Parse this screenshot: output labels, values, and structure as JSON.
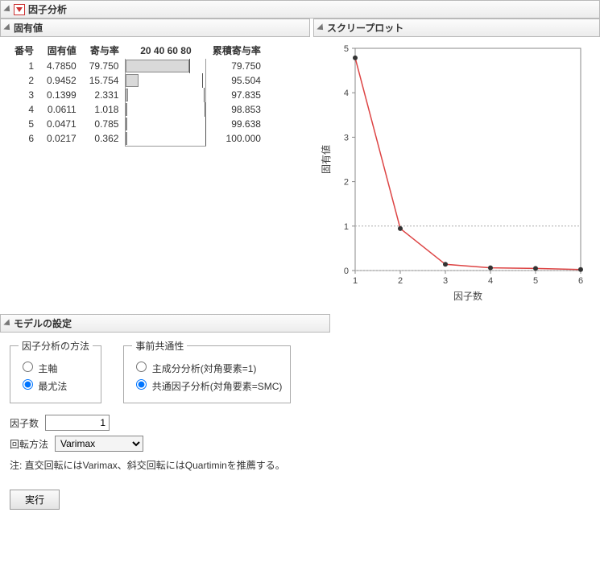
{
  "title": "因子分析",
  "eigen": {
    "title": "固有値",
    "headers": {
      "num": "番号",
      "eigen": "固有値",
      "contrib": "寄与率",
      "bar": "20 40 60 80",
      "cum": "累積寄与率"
    },
    "rows": [
      {
        "num": "1",
        "eigen": "4.7850",
        "contrib": "79.750",
        "cum": "79.750"
      },
      {
        "num": "2",
        "eigen": "0.9452",
        "contrib": "15.754",
        "cum": "95.504"
      },
      {
        "num": "3",
        "eigen": "0.1399",
        "contrib": "2.331",
        "cum": "97.835"
      },
      {
        "num": "4",
        "eigen": "0.0611",
        "contrib": "1.018",
        "cum": "98.853"
      },
      {
        "num": "5",
        "eigen": "0.0471",
        "contrib": "0.785",
        "cum": "99.638"
      },
      {
        "num": "6",
        "eigen": "0.0217",
        "contrib": "0.362",
        "cum": "100.000"
      }
    ]
  },
  "scree": {
    "title": "スクリープロット",
    "xlabel": "因子数",
    "ylabel": "固有値"
  },
  "model": {
    "title": "モデルの設定",
    "method_legend": "因子分析の方法",
    "method_opts": {
      "pa": "主軸",
      "ml": "最尤法"
    },
    "prior_legend": "事前共通性",
    "prior_opts": {
      "pca": "主成分分析(対角要素=1)",
      "cfa": "共通因子分析(対角要素=SMC)"
    },
    "nfactors_label": "因子数",
    "nfactors_value": "1",
    "rotation_label": "回転方法",
    "rotation_value": "Varimax",
    "note": "注: 直交回転にはVarimax、斜交回転にはQuartiminを推薦する。",
    "go": "実行"
  },
  "chart_data": {
    "type": "line",
    "title": "スクリープロット",
    "xlabel": "因子数",
    "ylabel": "固有値",
    "x": [
      1,
      2,
      3,
      4,
      5,
      6
    ],
    "values": [
      4.785,
      0.9452,
      0.1399,
      0.0611,
      0.0471,
      0.0217
    ],
    "ylim": [
      0,
      5
    ],
    "xlim": [
      1,
      6
    ],
    "ref_lines_y": [
      0,
      1
    ]
  }
}
